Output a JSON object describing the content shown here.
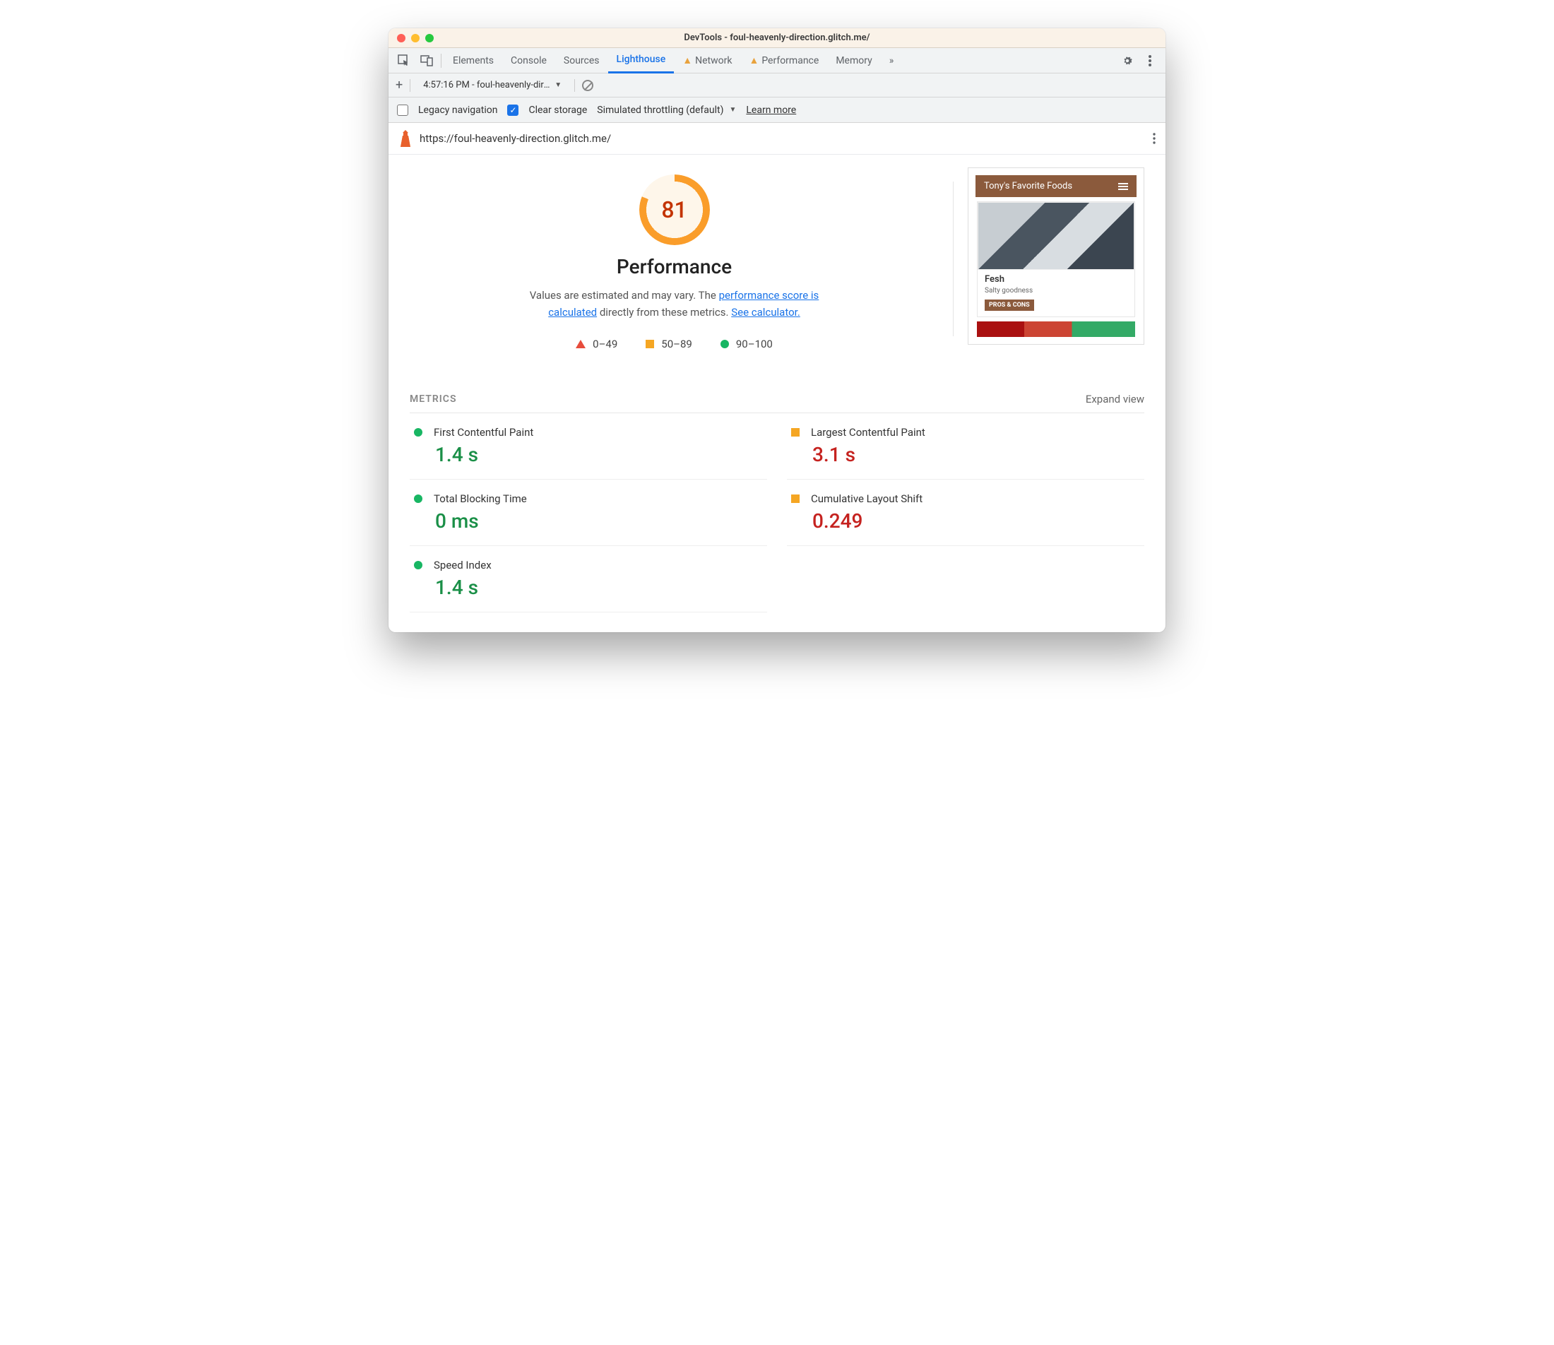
{
  "window": {
    "title": "DevTools - foul-heavenly-direction.glitch.me/"
  },
  "tabs": {
    "elements": "Elements",
    "console": "Console",
    "sources": "Sources",
    "lighthouse": "Lighthouse",
    "network": "Network",
    "performance": "Performance",
    "memory": "Memory"
  },
  "subbar": {
    "report_label": "4:57:16 PM - foul-heavenly-direction.glitch.me"
  },
  "options": {
    "legacy": "Legacy navigation",
    "clear": "Clear storage",
    "throttle": "Simulated throttling (default)",
    "learn": "Learn more"
  },
  "report": {
    "url": "https://foul-heavenly-direction.glitch.me/",
    "score": "81",
    "category": "Performance",
    "desc_pre": "Values are estimated and may vary. The ",
    "link1": "performance score is calculated",
    "desc_mid": " directly from these metrics. ",
    "link2": "See calculator."
  },
  "legend": {
    "r1": "0–49",
    "r2": "50–89",
    "r3": "90–100"
  },
  "preview": {
    "title": "Tony's Favorite Foods",
    "card_title": "Fesh",
    "card_sub": "Salty goodness",
    "btn": "PROS & CONS"
  },
  "metrics": {
    "heading": "METRICS",
    "expand": "Expand view",
    "items": [
      {
        "name": "First Contentful Paint",
        "value": "1.4 s",
        "status": "green"
      },
      {
        "name": "Largest Contentful Paint",
        "value": "3.1 s",
        "status": "orange"
      },
      {
        "name": "Total Blocking Time",
        "value": "0 ms",
        "status": "green"
      },
      {
        "name": "Cumulative Layout Shift",
        "value": "0.249",
        "status": "orange"
      },
      {
        "name": "Speed Index",
        "value": "1.4 s",
        "status": "green"
      }
    ]
  }
}
